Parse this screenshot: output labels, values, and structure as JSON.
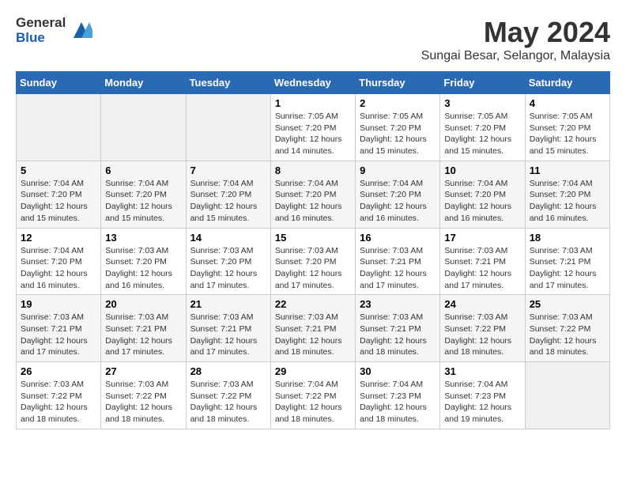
{
  "header": {
    "logo_general": "General",
    "logo_blue": "Blue",
    "month_title": "May 2024",
    "location": "Sungai Besar, Selangor, Malaysia"
  },
  "weekdays": [
    "Sunday",
    "Monday",
    "Tuesday",
    "Wednesday",
    "Thursday",
    "Friday",
    "Saturday"
  ],
  "weeks": [
    [
      {
        "day": "",
        "info": ""
      },
      {
        "day": "",
        "info": ""
      },
      {
        "day": "",
        "info": ""
      },
      {
        "day": "1",
        "info": "Sunrise: 7:05 AM\nSunset: 7:20 PM\nDaylight: 12 hours\nand 14 minutes."
      },
      {
        "day": "2",
        "info": "Sunrise: 7:05 AM\nSunset: 7:20 PM\nDaylight: 12 hours\nand 15 minutes."
      },
      {
        "day": "3",
        "info": "Sunrise: 7:05 AM\nSunset: 7:20 PM\nDaylight: 12 hours\nand 15 minutes."
      },
      {
        "day": "4",
        "info": "Sunrise: 7:05 AM\nSunset: 7:20 PM\nDaylight: 12 hours\nand 15 minutes."
      }
    ],
    [
      {
        "day": "5",
        "info": "Sunrise: 7:04 AM\nSunset: 7:20 PM\nDaylight: 12 hours\nand 15 minutes."
      },
      {
        "day": "6",
        "info": "Sunrise: 7:04 AM\nSunset: 7:20 PM\nDaylight: 12 hours\nand 15 minutes."
      },
      {
        "day": "7",
        "info": "Sunrise: 7:04 AM\nSunset: 7:20 PM\nDaylight: 12 hours\nand 15 minutes."
      },
      {
        "day": "8",
        "info": "Sunrise: 7:04 AM\nSunset: 7:20 PM\nDaylight: 12 hours\nand 16 minutes."
      },
      {
        "day": "9",
        "info": "Sunrise: 7:04 AM\nSunset: 7:20 PM\nDaylight: 12 hours\nand 16 minutes."
      },
      {
        "day": "10",
        "info": "Sunrise: 7:04 AM\nSunset: 7:20 PM\nDaylight: 12 hours\nand 16 minutes."
      },
      {
        "day": "11",
        "info": "Sunrise: 7:04 AM\nSunset: 7:20 PM\nDaylight: 12 hours\nand 16 minutes."
      }
    ],
    [
      {
        "day": "12",
        "info": "Sunrise: 7:04 AM\nSunset: 7:20 PM\nDaylight: 12 hours\nand 16 minutes."
      },
      {
        "day": "13",
        "info": "Sunrise: 7:03 AM\nSunset: 7:20 PM\nDaylight: 12 hours\nand 16 minutes."
      },
      {
        "day": "14",
        "info": "Sunrise: 7:03 AM\nSunset: 7:20 PM\nDaylight: 12 hours\nand 17 minutes."
      },
      {
        "day": "15",
        "info": "Sunrise: 7:03 AM\nSunset: 7:20 PM\nDaylight: 12 hours\nand 17 minutes."
      },
      {
        "day": "16",
        "info": "Sunrise: 7:03 AM\nSunset: 7:21 PM\nDaylight: 12 hours\nand 17 minutes."
      },
      {
        "day": "17",
        "info": "Sunrise: 7:03 AM\nSunset: 7:21 PM\nDaylight: 12 hours\nand 17 minutes."
      },
      {
        "day": "18",
        "info": "Sunrise: 7:03 AM\nSunset: 7:21 PM\nDaylight: 12 hours\nand 17 minutes."
      }
    ],
    [
      {
        "day": "19",
        "info": "Sunrise: 7:03 AM\nSunset: 7:21 PM\nDaylight: 12 hours\nand 17 minutes."
      },
      {
        "day": "20",
        "info": "Sunrise: 7:03 AM\nSunset: 7:21 PM\nDaylight: 12 hours\nand 17 minutes."
      },
      {
        "day": "21",
        "info": "Sunrise: 7:03 AM\nSunset: 7:21 PM\nDaylight: 12 hours\nand 17 minutes."
      },
      {
        "day": "22",
        "info": "Sunrise: 7:03 AM\nSunset: 7:21 PM\nDaylight: 12 hours\nand 18 minutes."
      },
      {
        "day": "23",
        "info": "Sunrise: 7:03 AM\nSunset: 7:21 PM\nDaylight: 12 hours\nand 18 minutes."
      },
      {
        "day": "24",
        "info": "Sunrise: 7:03 AM\nSunset: 7:22 PM\nDaylight: 12 hours\nand 18 minutes."
      },
      {
        "day": "25",
        "info": "Sunrise: 7:03 AM\nSunset: 7:22 PM\nDaylight: 12 hours\nand 18 minutes."
      }
    ],
    [
      {
        "day": "26",
        "info": "Sunrise: 7:03 AM\nSunset: 7:22 PM\nDaylight: 12 hours\nand 18 minutes."
      },
      {
        "day": "27",
        "info": "Sunrise: 7:03 AM\nSunset: 7:22 PM\nDaylight: 12 hours\nand 18 minutes."
      },
      {
        "day": "28",
        "info": "Sunrise: 7:03 AM\nSunset: 7:22 PM\nDaylight: 12 hours\nand 18 minutes."
      },
      {
        "day": "29",
        "info": "Sunrise: 7:04 AM\nSunset: 7:22 PM\nDaylight: 12 hours\nand 18 minutes."
      },
      {
        "day": "30",
        "info": "Sunrise: 7:04 AM\nSunset: 7:23 PM\nDaylight: 12 hours\nand 18 minutes."
      },
      {
        "day": "31",
        "info": "Sunrise: 7:04 AM\nSunset: 7:23 PM\nDaylight: 12 hours\nand 19 minutes."
      },
      {
        "day": "",
        "info": ""
      }
    ]
  ]
}
